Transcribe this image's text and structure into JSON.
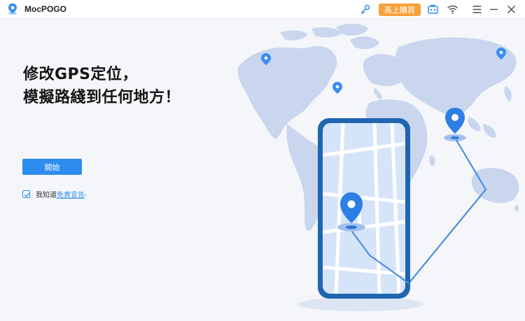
{
  "app": {
    "title": "MocPOGO",
    "logo_icon": "location-pin-logo"
  },
  "titlebar": {
    "buy_label": "馬上購買",
    "icons": [
      "key-icon",
      "toolbox-icon",
      "wifi-icon",
      "menu-icon",
      "minimize-icon",
      "close-icon"
    ]
  },
  "main": {
    "headline_line1": "修改GPS定位，",
    "headline_line2": "模擬路綫到任何地方！",
    "start_label": "開始",
    "agree_prefix": "我知道",
    "agree_link": "免責宣告",
    "agree_suffix": ".",
    "agree_checked": true
  },
  "colors": {
    "accent": "#2d8cf0",
    "buy": "#f7a23b",
    "map": "#c9d6ee",
    "phone_frame": "#1f65b0"
  }
}
